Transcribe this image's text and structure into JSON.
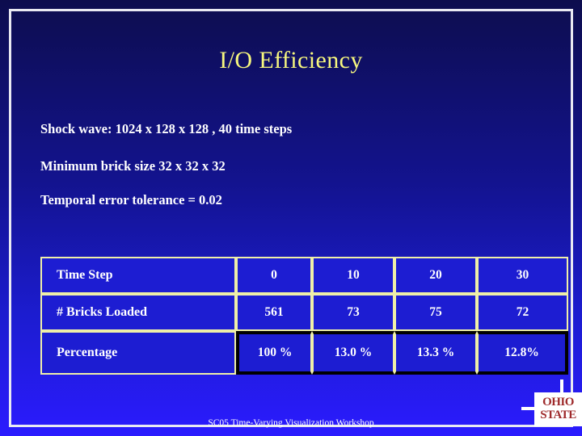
{
  "slide": {
    "title": "I/O Efficiency",
    "bullets": [
      "Shock wave: 1024 x 128 x 128 , 40 time steps",
      "Minimum brick size 32 x 32 x 32",
      "Temporal error tolerance = 0.02"
    ],
    "footer": "SC05 Time-Varying Visualization Workshop"
  },
  "table": {
    "rows": [
      {
        "label": "Time Step",
        "values": [
          "0",
          "10",
          "20",
          "30"
        ]
      },
      {
        "label": "# Bricks Loaded",
        "values": [
          "561",
          "73",
          "75",
          "72"
        ]
      },
      {
        "label": "Percentage",
        "values": [
          "100 %",
          "13.0 %",
          "13.3 %",
          "12.8%"
        ]
      }
    ]
  },
  "logo": {
    "line1": "OHIO",
    "line2": "STATE"
  },
  "colors": {
    "title": "#f7f77e",
    "text": "#ffffff",
    "cell_bg": "#1d1dd2",
    "cell_border": "#efefa8",
    "highlight_border": "#000000",
    "logo_text": "#9e2a2b",
    "bg_top": "#0d0d4e",
    "bg_bottom": "#2b1bff"
  }
}
